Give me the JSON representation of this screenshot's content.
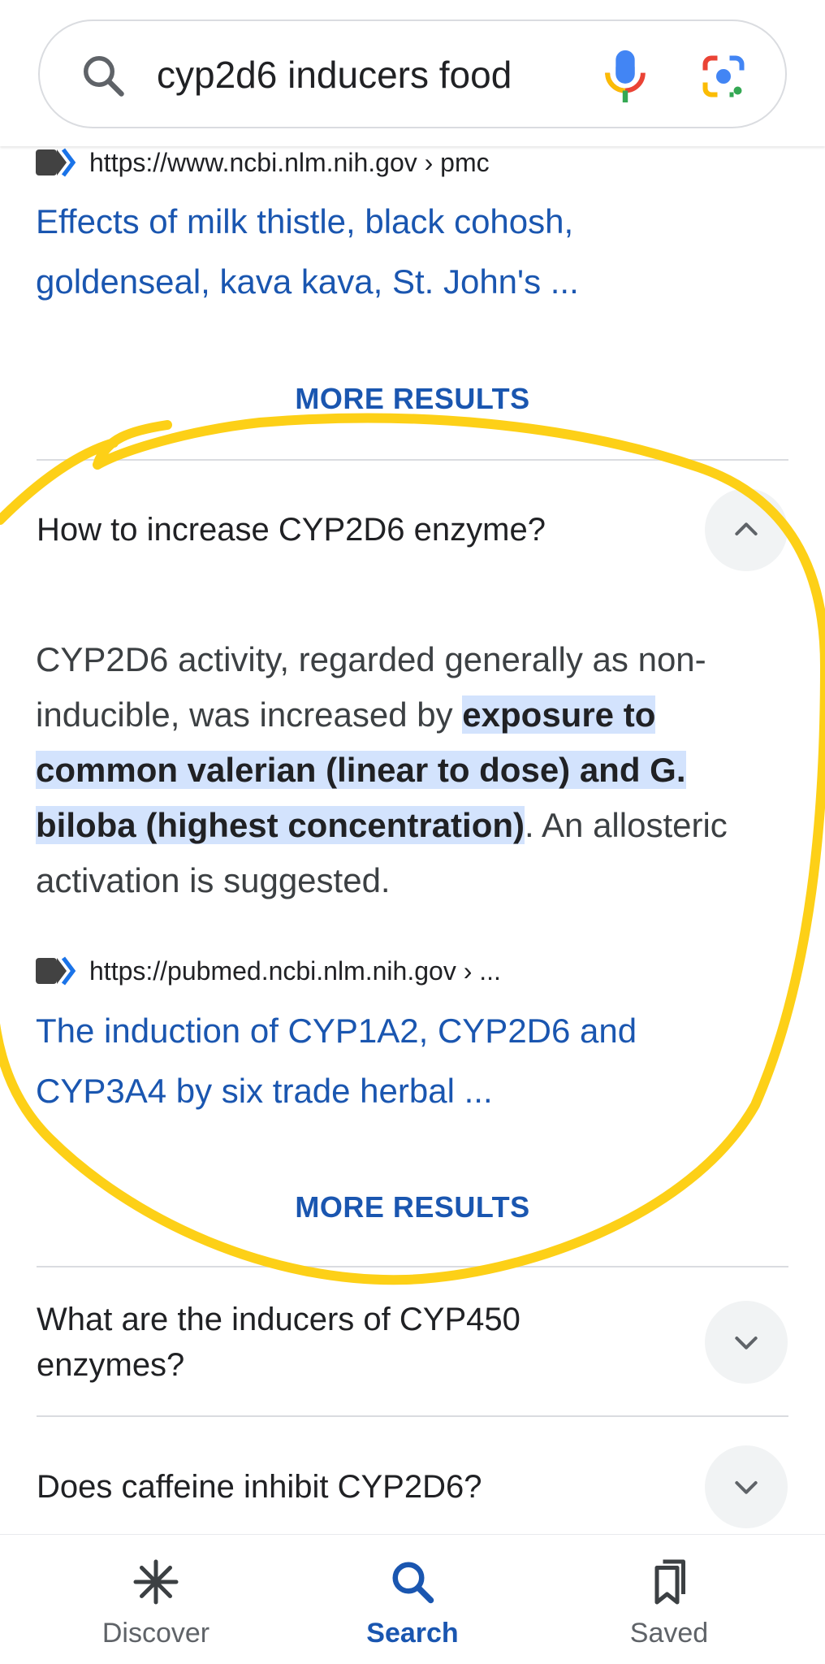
{
  "search": {
    "query": "cyp2d6 inducers food"
  },
  "results_top": {
    "source_url": "https://www.ncbi.nlm.nih.gov › pmc",
    "title_line1": "Effects of milk thistle, black cohosh,",
    "title_line2": "goldenseal, kava kava, St. John's ...",
    "more_results_label": "MORE RESULTS"
  },
  "questions": [
    {
      "text": "How to increase CYP2D6 enzyme?",
      "expanded": true,
      "answer_before": "CYP2D6 activity, regarded generally as non-inducible, was increased by ",
      "answer_highlight": "exposure to common valerian (linear to dose) and G. biloba (highest concentration)",
      "answer_after": ". An allosteric activation is suggested.",
      "source_url": "https://pubmed.ncbi.nlm.nih.gov › ...",
      "link_line1": "The induction of CYP1A2, CYP2D6 and",
      "link_line2": "CYP3A4 by six trade herbal ...",
      "more_results_label": "MORE RESULTS"
    },
    {
      "text": "What are the inducers of CYP450 enzymes?",
      "expanded": false
    },
    {
      "text": "Does caffeine inhibit CYP2D6?",
      "expanded": false
    }
  ],
  "bottom_nav": {
    "items": [
      {
        "label": "Discover",
        "icon": "asterisk-icon",
        "active": false
      },
      {
        "label": "Search",
        "icon": "search-icon",
        "active": true
      },
      {
        "label": "Saved",
        "icon": "bookmarks-icon",
        "active": false
      }
    ]
  },
  "colors": {
    "link": "#1a56b0",
    "highlight": "#d3e3fd",
    "annotation": "#fdd017",
    "divider": "#dadce0"
  }
}
